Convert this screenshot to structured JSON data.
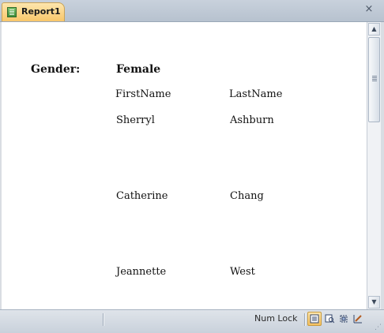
{
  "tab": {
    "title": "Report1",
    "close_symbol": "×"
  },
  "report": {
    "group_label": "Gender:",
    "group_value": "Female",
    "columns": [
      "FirstName",
      "LastName"
    ],
    "rows": [
      {
        "first": "Sherryl",
        "last": "Ashburn"
      },
      {
        "first": "Catherine",
        "last": "Chang"
      },
      {
        "first": "Jeannette",
        "last": "West"
      }
    ]
  },
  "scrollbar": {
    "up_arrow": "▲",
    "down_arrow": "▼"
  },
  "status": {
    "num_lock": "Num Lock",
    "view_icons": [
      "report-view-icon",
      "print-preview-icon",
      "layout-view-icon",
      "design-view-icon"
    ]
  },
  "colors": {
    "tab_active": "#f8c66a",
    "tab_border": "#c9a357"
  }
}
